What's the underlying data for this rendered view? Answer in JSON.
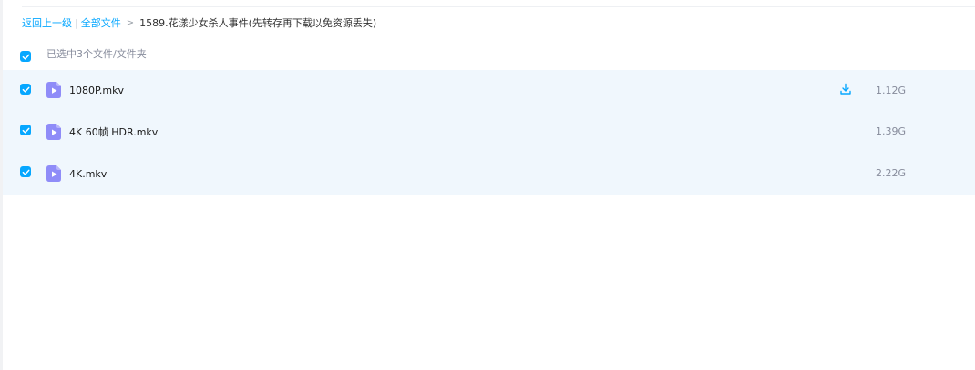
{
  "breadcrumb": {
    "back_label": "返回上一级",
    "separator": "|",
    "all_files_label": "全部文件",
    "arrow": ">",
    "current_folder": "1589.花漾少女杀人事件(先转存再下载以免资源丢失)"
  },
  "selection": {
    "summary": "已选中3个文件/文件夹",
    "all_checked": true
  },
  "files": [
    {
      "name": "1080P.mkv",
      "size": "1.12G",
      "checked": true,
      "icon": "video-file-icon",
      "show_download": true
    },
    {
      "name": "4K 60帧 HDR.mkv",
      "size": "1.39G",
      "checked": true,
      "icon": "video-file-icon",
      "show_download": false
    },
    {
      "name": "4K.mkv",
      "size": "2.22G",
      "checked": true,
      "icon": "video-file-icon",
      "show_download": false
    }
  ],
  "colors": {
    "accent": "#06a7ff",
    "row_selected_bg": "#f0f7fd",
    "video_icon": "#8f8cf8",
    "muted_text": "#878c9c"
  }
}
